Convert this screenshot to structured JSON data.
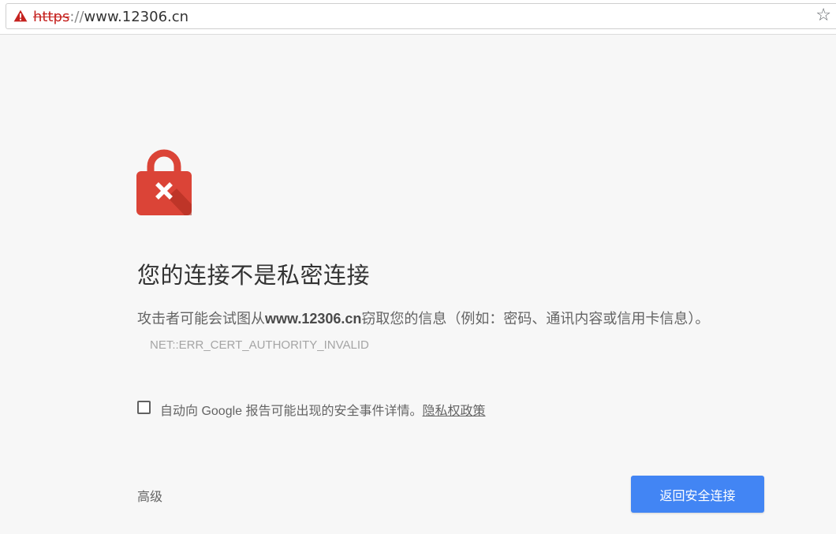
{
  "address_bar": {
    "scheme": "https",
    "separator": "://",
    "host": "www.12306.cn",
    "security_icon": "warning-triangle-icon",
    "bookmark_icon": "star-icon"
  },
  "interstitial": {
    "icon": "lock-error-icon",
    "title": "您的连接不是私密连接",
    "description_prefix": "攻击者可能会试图从",
    "description_host": "www.12306.cn",
    "description_suffix": "窃取您的信息（例如：密码、通讯内容或信用卡信息）。",
    "error_code": "NET::ERR_CERT_AUTHORITY_INVALID",
    "report_checkbox_label": "自动向 Google 报告可能出现的安全事件详情。",
    "privacy_link": "隐私权政策",
    "advanced_label": "高级",
    "back_button_label": "返回安全连接"
  },
  "colors": {
    "background": "#f7f7f7",
    "lock_red": "#db4437",
    "button_blue": "#4285f4",
    "warning_red": "#c5221f"
  }
}
